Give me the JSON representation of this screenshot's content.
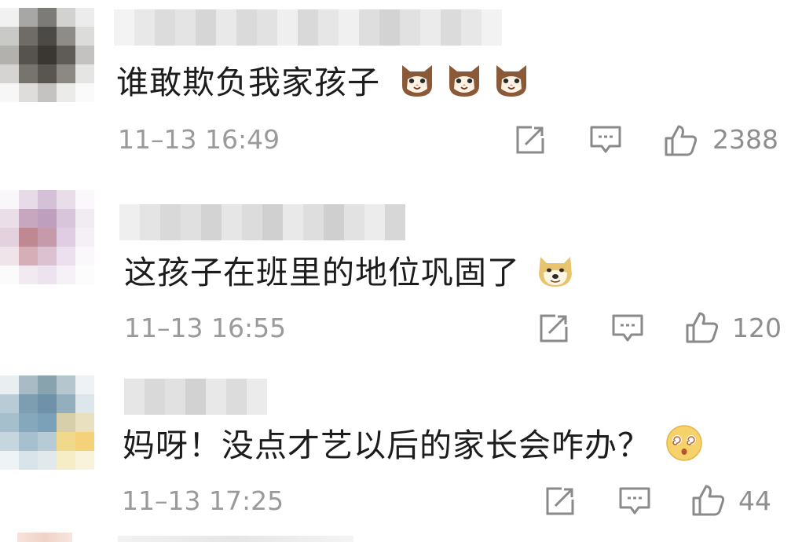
{
  "comments": [
    {
      "text": "谁敢欺负我家孩子",
      "emojis": [
        "cat-face-icon",
        "cat-face-icon",
        "cat-face-icon"
      ],
      "time": "11–13 16:49",
      "likes": "2388"
    },
    {
      "text": "这孩子在班里的地位巩固了",
      "emojis": [
        "doge-face-icon"
      ],
      "time": "11–13 16:55",
      "likes": "120"
    },
    {
      "text": "妈呀！没点才艺以后的家长会咋办？",
      "emojis": [
        "dizzy-face-icon"
      ],
      "time": "11–13 17:25",
      "likes": "44"
    }
  ],
  "colors": {
    "text": "#1c1c1c",
    "meta": "#9a9a9a",
    "icon": "#8a8a8a"
  }
}
